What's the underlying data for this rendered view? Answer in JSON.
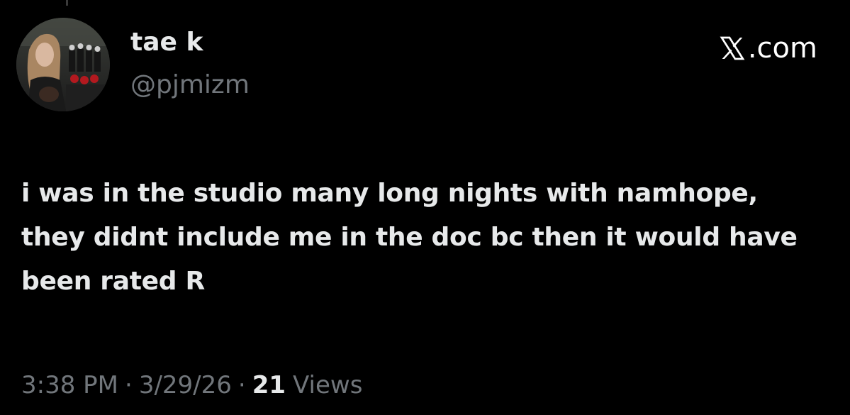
{
  "user": {
    "display_name": "tae k",
    "handle": "@pjmizm",
    "avatar_icon": "profile-photo"
  },
  "brand": {
    "icon": "x-logo-icon",
    "label": ".com"
  },
  "tweet": {
    "text": "i was in the studio many long nights with namhope, they didnt include me in the doc bc then it would have been rated R"
  },
  "meta": {
    "time": "3:38 PM",
    "date": "3/29/26",
    "separator": "·",
    "views_count": "21",
    "views_label": "Views"
  },
  "colors": {
    "background": "#000000",
    "primary_text": "#e7e9ea",
    "secondary_text": "#71767b"
  }
}
